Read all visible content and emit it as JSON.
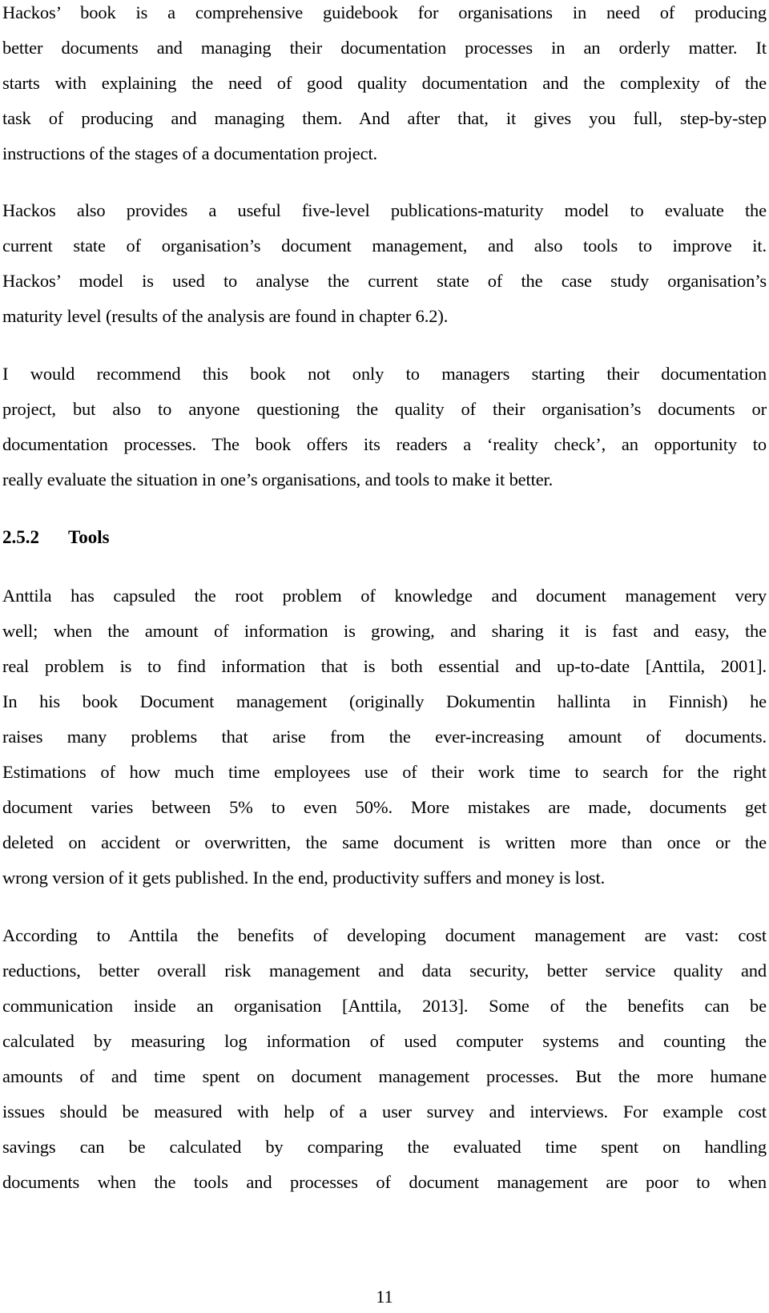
{
  "document": {
    "paragraphs": [
      {
        "lines": [
          "Hackos’ book is a comprehensive guidebook for organisations in need of producing",
          "better documents and managing their documentation processes in an orderly matter. It",
          "starts with explaining the need of good quality documentation and the complexity of the",
          "task of producing and managing them. And after that, it gives you full, step-by-step",
          "instructions of the stages of a documentation project."
        ]
      },
      {
        "lines": [
          "Hackos also provides a useful five-level publications-maturity model to evaluate the",
          "current state of organisation’s document management, and also tools to improve it.",
          "Hackos’ model is used to analyse the current state of the case study organisation’s",
          "maturity level (results of the analysis are found in chapter 6.2)."
        ]
      },
      {
        "lines": [
          "I would recommend this book not only to managers starting their documentation",
          "project, but also to anyone questioning the quality of their organisation’s documents or",
          "documentation processes. The book offers its readers a ‘reality check’, an opportunity to",
          "really evaluate the situation in one’s organisations, and tools to make it better."
        ]
      }
    ],
    "section_heading": {
      "number": "2.5.2",
      "title": "Tools"
    },
    "section_paragraphs": [
      {
        "lines": [
          "Anttila has capsuled the root problem of knowledge and document management very",
          "well; when the amount of information is growing, and sharing it is fast and easy, the",
          "real problem is to find information that is both essential and up-to-date [Anttila, 2001].",
          "In his book Document management (originally Dokumentin hallinta in Finnish) he",
          "raises many problems that arise from the ever-increasing amount of documents.",
          "Estimations of how much time employees use of their work time to search for the right",
          "document varies between 5% to even 50%. More mistakes are made, documents get",
          "deleted on accident or overwritten, the same document is written more than once or the",
          "wrong version of it gets published. In the end, productivity suffers and money is lost."
        ]
      },
      {
        "lines": [
          "According to Anttila the benefits of developing document management are vast: cost",
          "reductions, better overall risk management and data security, better service quality and",
          "communication inside an organisation [Anttila, 2013]. Some of the benefits can be",
          "calculated by measuring log information of used computer systems and counting the",
          "amounts of and time spent on document management processes. But the more humane",
          "issues should be measured with help of a user survey and interviews. For example cost",
          "savings can be calculated by comparing the evaluated time spent on handling",
          "documents when the tools and processes of document management are poor to when"
        ]
      }
    ],
    "page_number": "11"
  }
}
